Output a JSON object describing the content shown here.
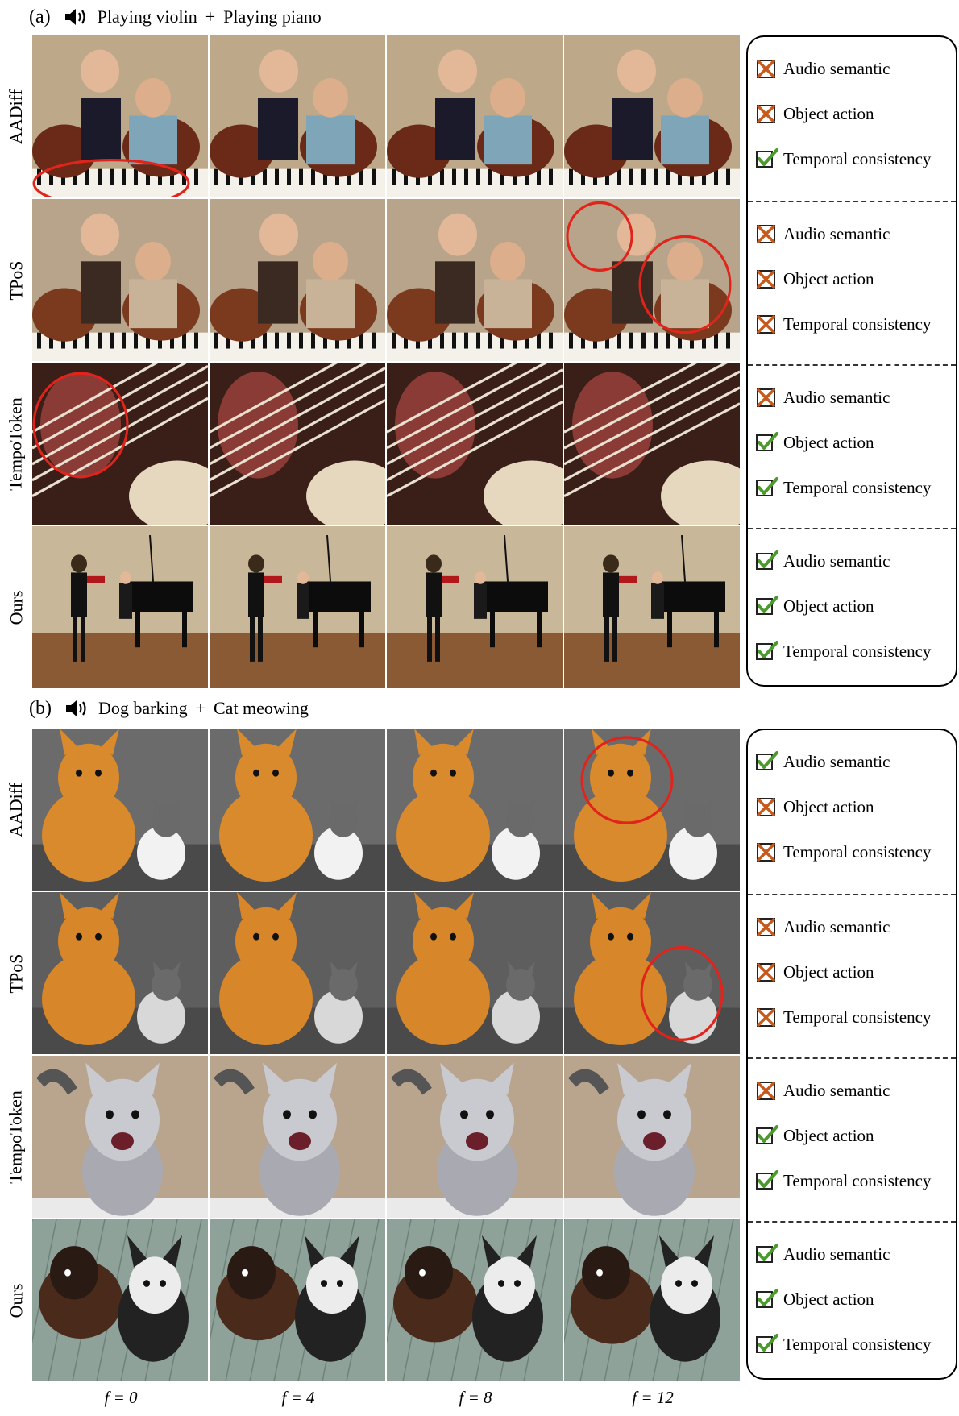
{
  "panels": [
    {
      "letter": "(a)",
      "audio": [
        "Playing violin",
        "Playing piano"
      ],
      "plus": "+",
      "rows": [
        {
          "method": "AADiff",
          "criteria": [
            {
              "label": "Audio semantic",
              "status": "fail"
            },
            {
              "label": "Object action",
              "status": "fail"
            },
            {
              "label": "Temporal consistency",
              "status": "pass"
            }
          ]
        },
        {
          "method": "TPoS",
          "criteria": [
            {
              "label": "Audio semantic",
              "status": "fail"
            },
            {
              "label": "Object action",
              "status": "fail"
            },
            {
              "label": "Temporal consistency",
              "status": "fail"
            }
          ]
        },
        {
          "method": "TempoToken",
          "criteria": [
            {
              "label": "Audio semantic",
              "status": "fail"
            },
            {
              "label": "Object action",
              "status": "pass"
            },
            {
              "label": "Temporal consistency",
              "status": "pass"
            }
          ]
        },
        {
          "method": "Ours",
          "criteria": [
            {
              "label": "Audio semantic",
              "status": "pass"
            },
            {
              "label": "Object action",
              "status": "pass"
            },
            {
              "label": "Temporal consistency",
              "status": "pass"
            }
          ]
        }
      ]
    },
    {
      "letter": "(b)",
      "audio": [
        "Dog barking",
        "Cat meowing"
      ],
      "plus": "+",
      "rows": [
        {
          "method": "AADiff",
          "criteria": [
            {
              "label": "Audio semantic",
              "status": "pass"
            },
            {
              "label": "Object action",
              "status": "fail"
            },
            {
              "label": "Temporal consistency",
              "status": "fail"
            }
          ]
        },
        {
          "method": "TPoS",
          "criteria": [
            {
              "label": "Audio semantic",
              "status": "fail"
            },
            {
              "label": "Object action",
              "status": "fail"
            },
            {
              "label": "Temporal consistency",
              "status": "fail"
            }
          ]
        },
        {
          "method": "TempoToken",
          "criteria": [
            {
              "label": "Audio semantic",
              "status": "fail"
            },
            {
              "label": "Object action",
              "status": "pass"
            },
            {
              "label": "Temporal consistency",
              "status": "pass"
            }
          ]
        },
        {
          "method": "Ours",
          "criteria": [
            {
              "label": "Audio semantic",
              "status": "pass"
            },
            {
              "label": "Object action",
              "status": "pass"
            },
            {
              "label": "Temporal consistency",
              "status": "pass"
            }
          ]
        }
      ]
    }
  ],
  "frame_labels": [
    "f = 0",
    "f = 4",
    "f = 8",
    "f = 12"
  ],
  "colors": {
    "pass_check": "#4a9a2c",
    "fail_x": "#c8591c",
    "highlight_circle": "#e0241c"
  },
  "icons": {
    "speaker": "speaker-icon",
    "pass": "check-icon",
    "fail": "cross-icon"
  }
}
